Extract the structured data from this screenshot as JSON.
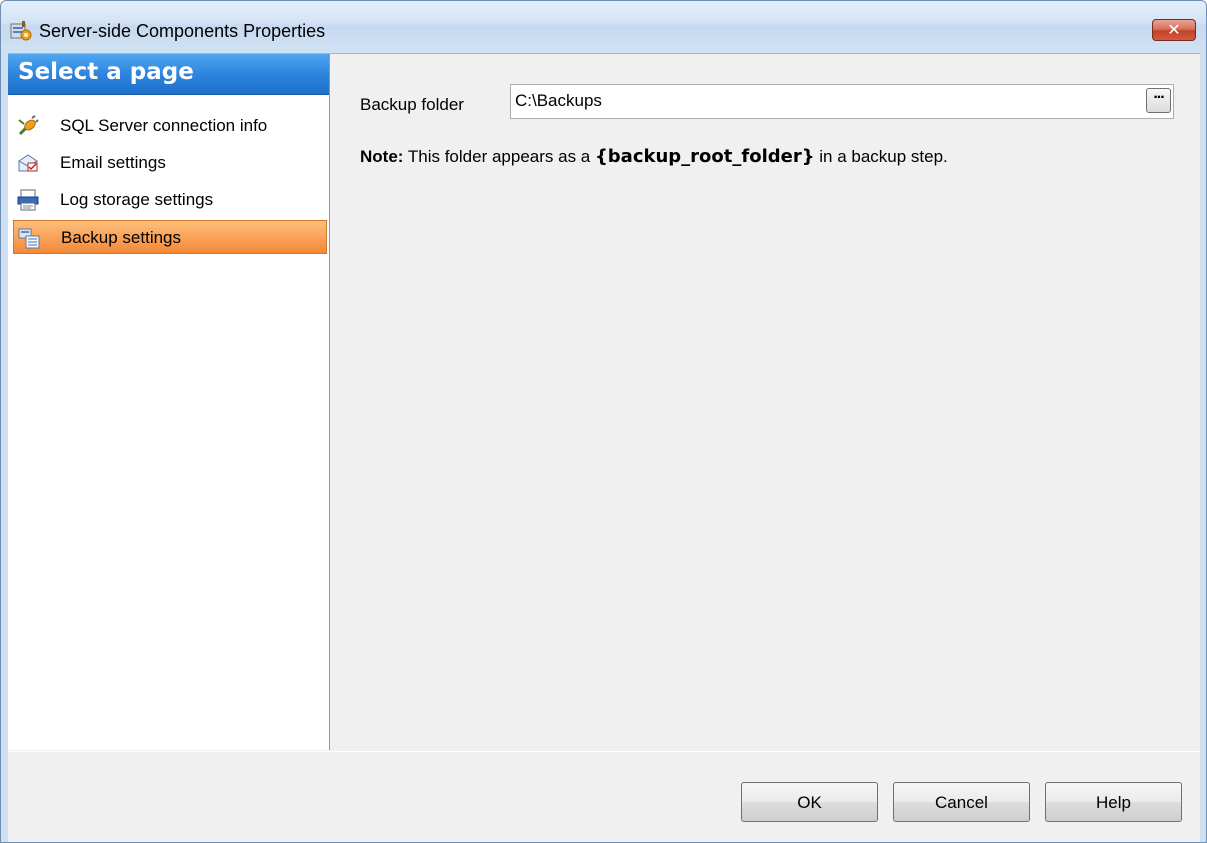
{
  "window": {
    "title": "Server-side Components Properties",
    "close_glyph": "✕",
    "icon": "settings-app-icon"
  },
  "sidebar": {
    "header": "Select a page",
    "items": [
      {
        "label": "SQL Server connection info",
        "icon": "connection-plug-icon",
        "selected": false
      },
      {
        "label": "Email settings",
        "icon": "email-icon",
        "selected": false
      },
      {
        "label": "Log storage settings",
        "icon": "log-storage-icon",
        "selected": false
      },
      {
        "label": "Backup settings",
        "icon": "backup-settings-icon",
        "selected": true
      }
    ]
  },
  "backup": {
    "folder_label": "Backup folder",
    "folder_value": "C:\\Backups",
    "browse_glyph": "...",
    "note_prefix": "Note:",
    "note_text_1": " This folder appears as a ",
    "note_variable": "{backup_root_folder}",
    "note_text_2": " in a backup step."
  },
  "buttons": {
    "ok": "OK",
    "cancel": "Cancel",
    "help": "Help"
  },
  "colors": {
    "header_blue": "#2e85dc",
    "selected_orange": "#f9a25a"
  }
}
